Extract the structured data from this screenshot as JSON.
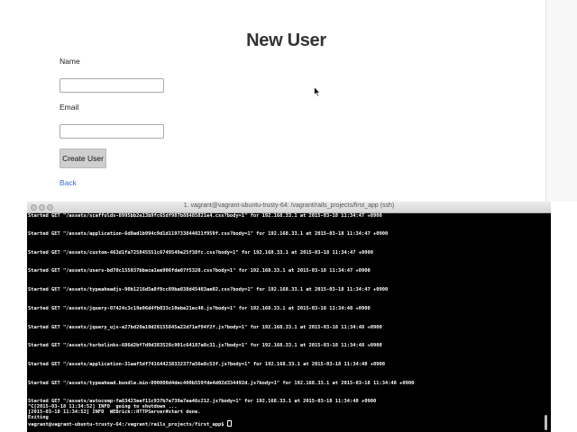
{
  "page": {
    "title": "New User",
    "name_label": "Name",
    "email_label": "Email",
    "name_value": "",
    "email_value": "",
    "submit_label": "Create User",
    "back_link": "Back"
  },
  "terminal": {
    "title": "1. vagrant@vagrant-ubuntu-trusty-64: /vagrant/rails_projects/first_app (ssh)",
    "log_lines": [
      "Started GET \"/assets/scaffolds-8995bb2e13b9fc65df987b88485821e4.css?body=1\" for 192.168.33.1 at 2015-03-18 11:34:47 +0900",
      "Started GET \"/assets/application-6d0ad1b994c9d1d119733844021f959f.css?body=1\" for 192.168.33.1 at 2015-03-18 11:34:47 +0900",
      "Started GET \"/assets/custom-463d1fa725845551c6749549e25f38fc.css?body=1\" for 192.168.33.1 at 2015-03-18 11:34:47 +0900",
      "Started GET \"/assets/users-bd70c155037bbeca1ee906fda07f5320.css?body=1\" for 192.168.33.1 at 2015-03-18 11:34:47 +0900",
      "Started GET \"/assets/typeaheadjs-90b1216d5a8f8cc89ba038d45403ae02.css?body=1\" for 192.168.33.1 at 2015-03-18 11:34:47 +0900",
      "Started GET \"/assets/jquery-07424c3c19e96d4fb033c10ebe21ec40.js?body=1\" for 192.168.33.1 at 2015-03-18 11:34:48 +0900",
      "Started GET \"/assets/jquery_ujs-e27bd20a10d28155845a22d71ef94f2f.js?body=1\" for 192.168.33.1 at 2015-03-18 11:34:48 +0900",
      "Started GET \"/assets/turbolinks-686d2bf7d9d383528c901c64187a8c31.js?body=1\" for 192.168.33.1 at 2015-03-18 11:34:48 +0900",
      "Started GET \"/assets/application-31aaf5df741644238332377a56e8c53f.js?body=1\" for 192.168.33.1 at 2015-03-18 11:34:48 +0900",
      "Started GET \"/assets/typeahead.bundle.min-090000d4dec400b559fde4d02d334492d.js?body=1\" for 192.168.33.1 at 2015-03-18 11:34:48 +0900",
      "Started GET \"/assets/autocomp-fa63423eef11c937b7e739a7ea46c212.js?body=1\" for 192.168.33.1 at 2015-03-18 11:34:48 +0900"
    ],
    "tail_lines": [
      "^C[2015-03-18 11:34:52] INFO  going to shutdown ...",
      "[2015-03-18 11:34:52] INFO  WEBrick::HTTPServer#start done.",
      "Exiting"
    ],
    "prompt": "vagrant@vagrant-ubuntu-trusty-64:/vagrant/rails_projects/first_app$ "
  },
  "icons": {
    "cursor": "mouse-pointer-icon",
    "window_buttons": [
      "close-window-icon",
      "minimize-window-icon",
      "zoom-window-icon"
    ]
  },
  "colors": {
    "link": "#3b6bd6",
    "button_bg": "#cfcfcf",
    "terminal_bg": "#000000",
    "terminal_fg": "#ffffff"
  }
}
